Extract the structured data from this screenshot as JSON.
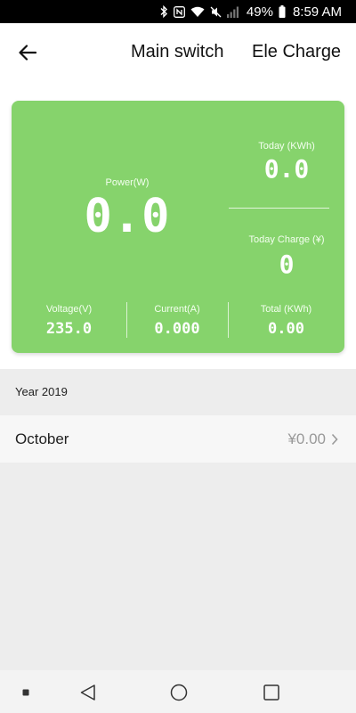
{
  "status_bar": {
    "battery_percent": "49%",
    "time": "8:59 AM",
    "icons": [
      "bluetooth-icon",
      "nfc-icon",
      "wifi-icon",
      "mute-icon",
      "signal-icon",
      "battery-icon"
    ]
  },
  "header": {
    "back_icon": "back-arrow-icon",
    "tab_main": "Main switch",
    "tab_charge": "Ele Charge"
  },
  "card": {
    "background_color": "#86d36c",
    "power_label": "Power(W)",
    "power_value": "0.0",
    "today_label": "Today (KWh)",
    "today_value": "0.0",
    "today_charge_label": "Today Charge (¥)",
    "today_charge_value": "0",
    "voltage_label": "Voltage(V)",
    "voltage_value": "235.0",
    "current_label": "Current(A)",
    "current_value": "0.000",
    "total_label": "Total (KWh)",
    "total_value": "0.00"
  },
  "history": {
    "year_label": "Year 2019",
    "rows": [
      {
        "month": "October",
        "amount": "¥0.00"
      }
    ]
  },
  "nav_bar": {
    "icons": [
      "overview-dot-icon",
      "back-triangle-icon",
      "home-circle-icon",
      "recents-square-icon"
    ]
  }
}
